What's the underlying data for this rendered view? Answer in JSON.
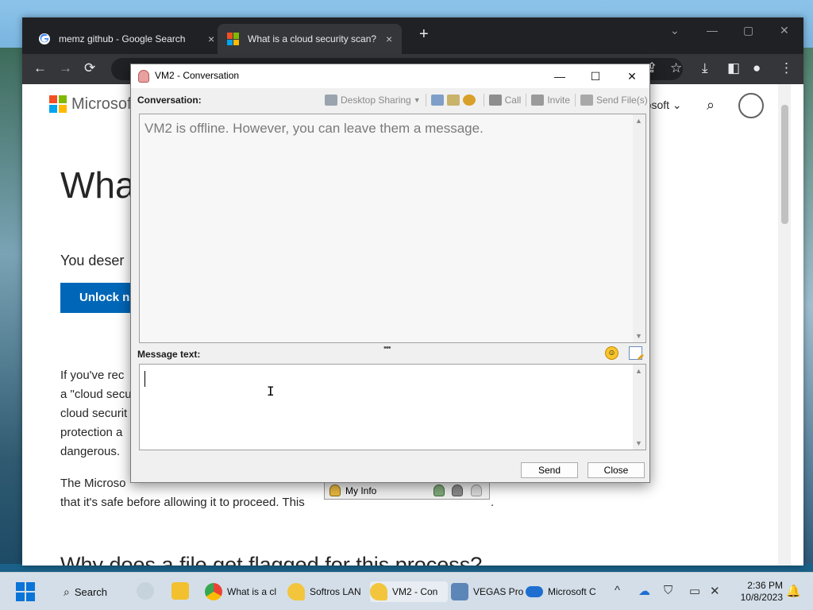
{
  "browser": {
    "tabs": [
      {
        "title": "memz github - Google Search",
        "close": "×"
      },
      {
        "title": "What is a cloud security scan? - M",
        "close": "×"
      }
    ],
    "new_tab": "+",
    "nav": {
      "back": "←",
      "forward": "→",
      "reload": "⟳"
    },
    "window_controls": {
      "dropdown": "⌄",
      "minimize": "—",
      "maximize": "▢",
      "close": "✕"
    },
    "toolbar_icons": {
      "share": "⇪",
      "star": "☆",
      "download": "⤓",
      "sidebar": "◧",
      "profile": "●",
      "menu": "⋮"
    }
  },
  "page": {
    "brand": "Microsoft",
    "nav_partial": "rosoft ⌄",
    "search_icon": "⌕",
    "heading_partial": "Wha",
    "subheading_partial": "You deser",
    "unlock_button": "Unlock no",
    "paragraph1": [
      "If you've rec",
      "a \"cloud secu",
      "cloud securit",
      "protection a",
      "dangerous."
    ],
    "paragraph2": [
      "The Microso",
      "that it's safe before allowing it to proceed. This"
    ],
    "paragraph2_tail": ".",
    "heading2": "Why does a file get flagged for this process?"
  },
  "conversation_window": {
    "title": "VM2 - Conversation",
    "controls": {
      "minimize": "—",
      "maximize": "☐",
      "close": "✕"
    },
    "conversation_label": "Conversation:",
    "toolbar": {
      "desktop_sharing": "Desktop Sharing",
      "call": "Call",
      "invite": "Invite",
      "send_files": "Send File(s)"
    },
    "offline_message": "VM2 is offline. However, you can leave them a message.",
    "message_label": "Message text:",
    "splitter": "•••",
    "emoji": "☺",
    "send_button": "Send",
    "close_button": "Close"
  },
  "my_info": {
    "label": "My Info"
  },
  "taskbar": {
    "search": "Search",
    "apps": [
      {
        "label": "What is a cl"
      },
      {
        "label": "Softros LAN"
      },
      {
        "label": "VM2 - Con"
      },
      {
        "label": "VEGAS Pro"
      },
      {
        "label": "Microsoft C"
      }
    ],
    "tray_chevron": "^",
    "time": "2:36 PM",
    "date": "10/8/2023"
  },
  "colors": {
    "chrome_dark": "#202124",
    "ms_blue": "#0067b8",
    "ms_red": "#f25022",
    "ms_green": "#7fba00",
    "ms_blue_logo": "#00a4ef",
    "ms_yellow": "#ffb900"
  }
}
